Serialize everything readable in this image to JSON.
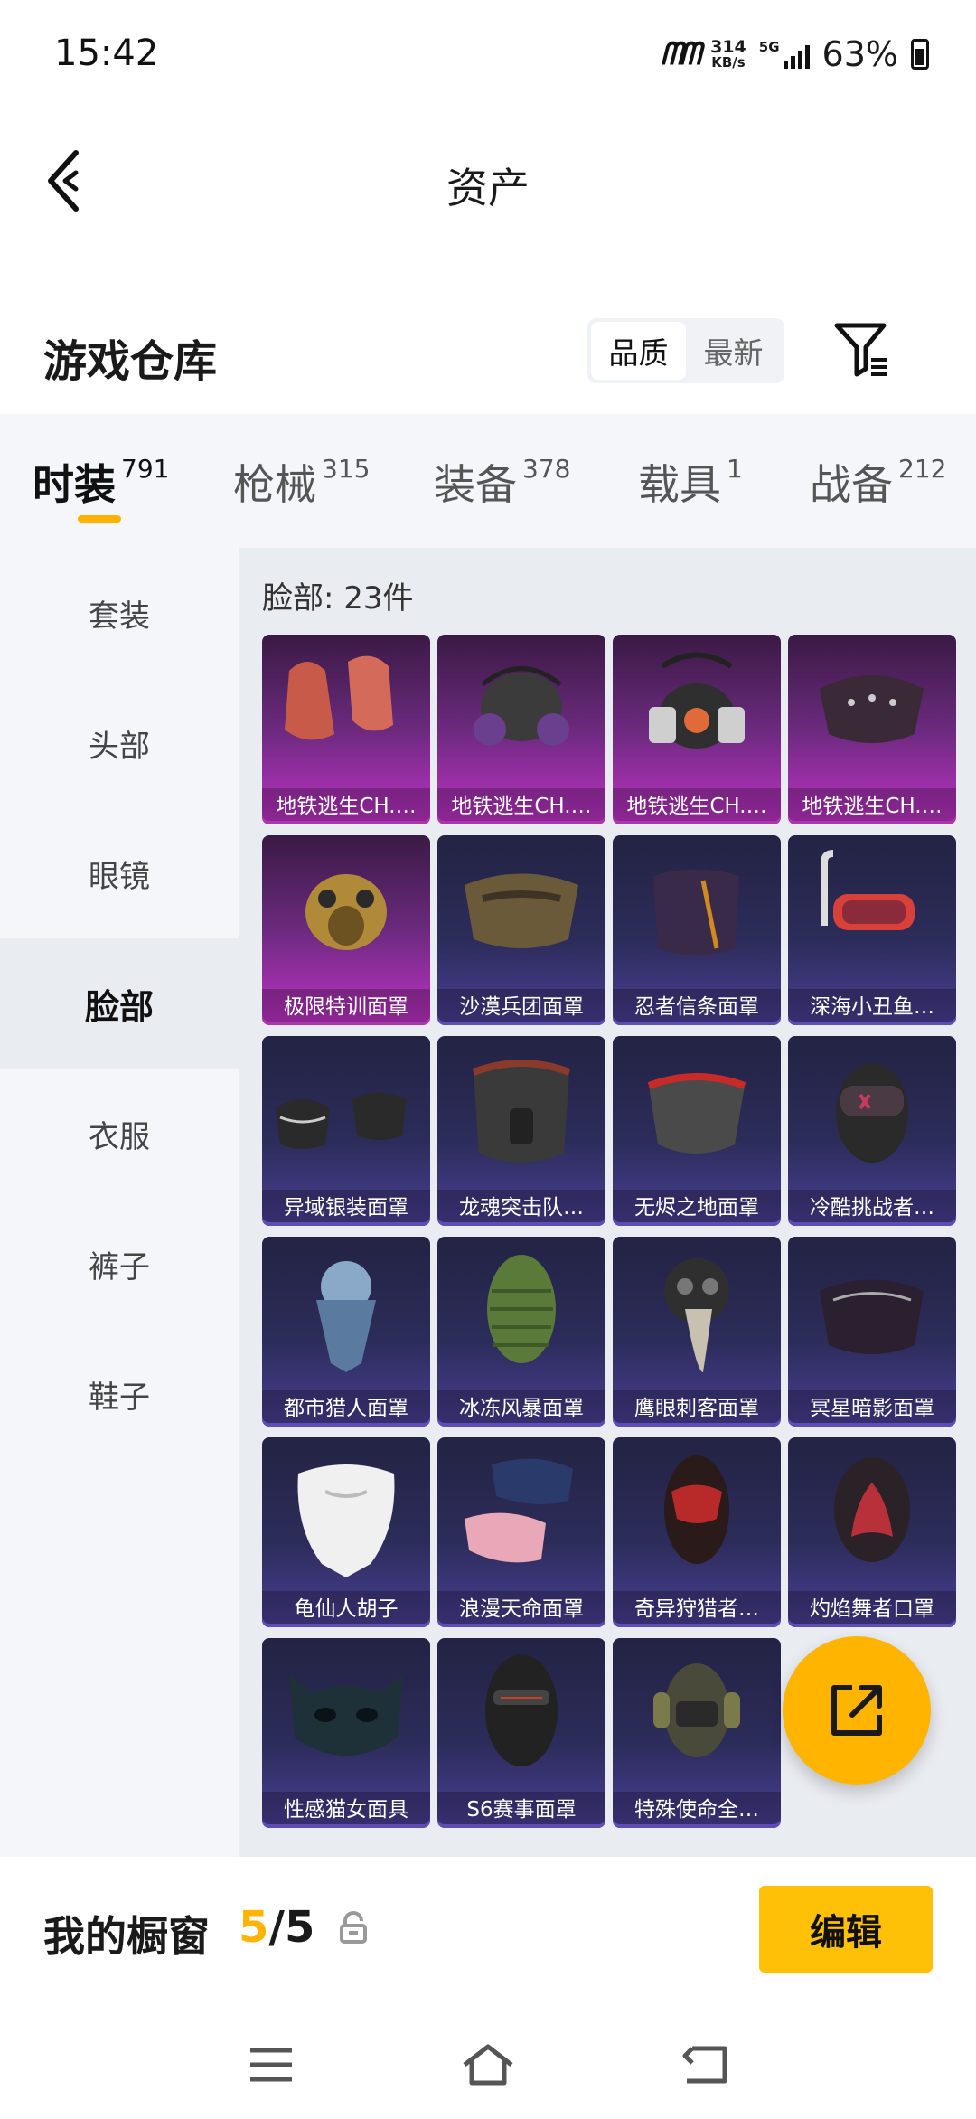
{
  "status_bar": {
    "time": "15:42",
    "carrier_logo": "ᗰᗰ",
    "speed_value": "314",
    "speed_unit": "KB/s",
    "network": "5G",
    "battery_percent": "63%"
  },
  "header": {
    "title": "资产",
    "back_icon": "chevron-left-icon"
  },
  "warehouse": {
    "title": "游戏仓库",
    "sort_options": [
      "品质",
      "最新"
    ],
    "sort_selected": "品质",
    "filter_icon": "filter-icon"
  },
  "tabs": [
    {
      "label": "时装",
      "count": "791",
      "active": true
    },
    {
      "label": "枪械",
      "count": "315",
      "active": false
    },
    {
      "label": "装备",
      "count": "378",
      "active": false
    },
    {
      "label": "载具",
      "count": "1",
      "active": false
    },
    {
      "label": "战备",
      "count": "212",
      "active": false
    }
  ],
  "sidebar": {
    "items": [
      {
        "label": "套装",
        "active": false
      },
      {
        "label": "头部",
        "active": false
      },
      {
        "label": "眼镜",
        "active": false
      },
      {
        "label": "脸部",
        "active": true
      },
      {
        "label": "衣服",
        "active": false
      },
      {
        "label": "裤子",
        "active": false
      },
      {
        "label": "鞋子",
        "active": false
      }
    ]
  },
  "grid": {
    "count_label": "脸部: 23件",
    "items": [
      {
        "name": "地铁逃生CH.…",
        "rarity": "purple",
        "icon": "bandana-mask-icon"
      },
      {
        "name": "地铁逃生CH.…",
        "rarity": "purple",
        "icon": "gas-mask-icon"
      },
      {
        "name": "地铁逃生CH.…",
        "rarity": "purple",
        "icon": "respirator-icon"
      },
      {
        "name": "地铁逃生CH.…",
        "rarity": "purple",
        "icon": "spiked-mask-icon"
      },
      {
        "name": "极限特训面罩",
        "rarity": "purple",
        "icon": "gold-gas-mask-icon"
      },
      {
        "name": "沙漠兵团面罩",
        "rarity": "blue",
        "icon": "camo-mask-icon"
      },
      {
        "name": "忍者信条面罩",
        "rarity": "blue",
        "icon": "ninja-mask-icon"
      },
      {
        "name": "深海小丑鱼…",
        "rarity": "blue",
        "icon": "snorkel-mask-icon"
      },
      {
        "name": "异域银装面罩",
        "rarity": "blue",
        "icon": "silver-mask-icon"
      },
      {
        "name": "龙魂突击队…",
        "rarity": "blue",
        "icon": "dragon-mask-icon"
      },
      {
        "name": "无烬之地面罩",
        "rarity": "blue",
        "icon": "red-trim-mask-icon"
      },
      {
        "name": "冷酷挑战者…",
        "rarity": "blue",
        "icon": "goggle-mask-icon"
      },
      {
        "name": "都市猎人面罩",
        "rarity": "blue",
        "icon": "scarf-mask-icon"
      },
      {
        "name": "冰冻风暴面罩",
        "rarity": "blue",
        "icon": "knit-mask-icon"
      },
      {
        "name": "鹰眼刺客面罩",
        "rarity": "blue",
        "icon": "plague-mask-icon"
      },
      {
        "name": "冥星暗影面罩",
        "rarity": "blue",
        "icon": "shadow-mask-icon"
      },
      {
        "name": "龟仙人胡子",
        "rarity": "blue",
        "icon": "beard-icon"
      },
      {
        "name": "浪漫天命面罩",
        "rarity": "blue",
        "icon": "cloth-mask-icon"
      },
      {
        "name": "奇异狩猎者…",
        "rarity": "blue",
        "icon": "hood-mask-icon"
      },
      {
        "name": "灼焰舞者口罩",
        "rarity": "blue",
        "icon": "flame-mask-icon"
      },
      {
        "name": "性感猫女面具",
        "rarity": "blue",
        "icon": "cat-mask-icon"
      },
      {
        "name": "S6赛事面罩",
        "rarity": "blue",
        "icon": "balaclava-icon"
      },
      {
        "name": "特殊使命全…",
        "rarity": "blue",
        "icon": "headset-mask-icon"
      }
    ]
  },
  "fab": {
    "icon": "share-icon"
  },
  "showcase": {
    "title": "我的橱窗",
    "current": "5",
    "separator": "/",
    "total": "5",
    "lock_icon": "lock-icon",
    "edit_label": "编辑"
  },
  "navbar": {
    "menu_icon": "menu-icon",
    "home_icon": "home-icon",
    "back_icon": "back-icon"
  },
  "colors": {
    "accent": "#ffb400",
    "edit_button": "#ffc107",
    "rarity_purple": "#c033c8",
    "rarity_blue": "#4a3f96"
  }
}
